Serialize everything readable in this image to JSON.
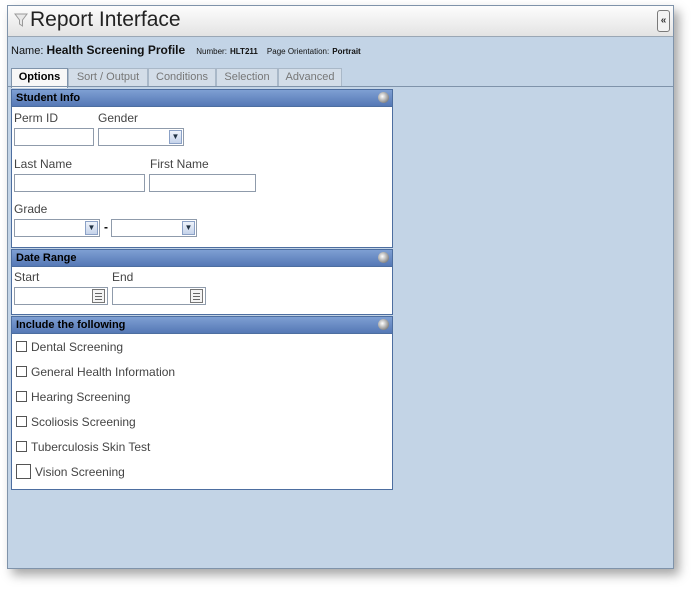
{
  "window": {
    "title": "Report Interface",
    "title_icon": "funnel-icon",
    "collapse_icon": "double-chevron-left-icon",
    "collapse_label": "«"
  },
  "report": {
    "name_label": "Name:",
    "name_value": "Health Screening Profile",
    "number_label": "Number:",
    "number_value": "HLT211",
    "orientation_label": "Page Orientation:",
    "orientation_value": "Portrait"
  },
  "tabs": [
    {
      "label": "Options",
      "active": true
    },
    {
      "label": "Sort / Output",
      "active": false
    },
    {
      "label": "Conditions",
      "active": false
    },
    {
      "label": "Selection",
      "active": false
    },
    {
      "label": "Advanced",
      "active": false
    }
  ],
  "student_info": {
    "title": "Student Info",
    "perm_id_label": "Perm ID",
    "perm_id_value": "",
    "gender_label": "Gender",
    "gender_value": "",
    "last_name_label": "Last Name",
    "last_name_value": "",
    "first_name_label": "First Name",
    "first_name_value": "",
    "grade_label": "Grade",
    "grade_from": "",
    "grade_separator": "-",
    "grade_to": ""
  },
  "date_range": {
    "title": "Date Range",
    "start_label": "Start",
    "start_value": "",
    "end_label": "End",
    "end_value": ""
  },
  "include": {
    "title": "Include the following",
    "items": [
      {
        "label": "Dental Screening",
        "checked": false
      },
      {
        "label": "General Health Information",
        "checked": false
      },
      {
        "label": "Hearing Screening",
        "checked": false
      },
      {
        "label": "Scoliosis Screening",
        "checked": false
      },
      {
        "label": "Tuberculosis Skin Test",
        "checked": false
      },
      {
        "label": "Vision Screening",
        "checked": false
      }
    ]
  },
  "colors": {
    "background": "#c3d4e6",
    "panel_header": "#6688c4",
    "panel_border": "#4d6ea0"
  }
}
